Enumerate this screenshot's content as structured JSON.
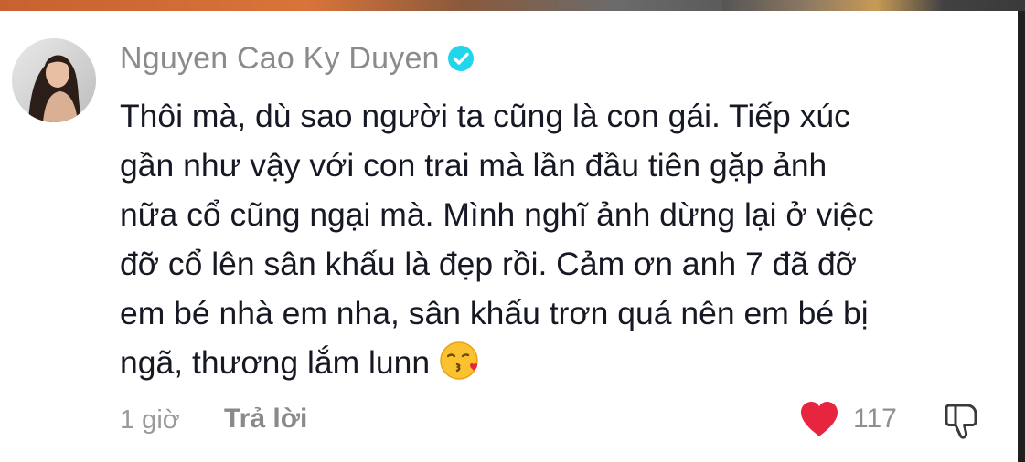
{
  "comment": {
    "author": "Nguyen Cao Ky Duyen",
    "verified_icon": "verified-badge-icon",
    "avatar_icon": "avatar",
    "text_lines": [
      "Thôi mà, dù sao người ta cũng là con gái. Tiếp xúc",
      "gần như vậy với con trai mà lần đầu tiên gặp ảnh",
      "nữa cổ cũng ngại mà. Mình nghĩ ảnh dừng lại ở việc",
      "đỡ cổ lên sân khấu là đẹp rồi. Cảm ơn anh 7 đã đỡ",
      "em bé nhà em nha, sân khấu trơn quá nên em bé bị",
      "ngã, thương lắm lunn"
    ],
    "emoji": "kissing-face-with-heart-emoji",
    "time_ago": "1 giờ",
    "reply_label": "Trả lời",
    "likes": "117",
    "like_icon": "heart-icon",
    "dislike_icon": "thumbs-down-icon"
  },
  "colors": {
    "author": "#8b8b8b",
    "text": "#161823",
    "verified": "#20d5ec",
    "heart": "#e8253f",
    "meta": "#9a9a9a"
  }
}
